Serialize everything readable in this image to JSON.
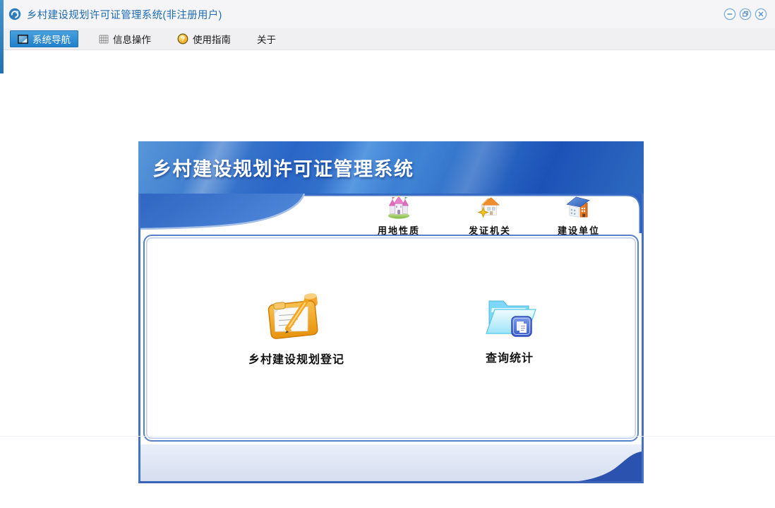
{
  "window": {
    "title": "乡村建设规划许可证管理系统(非注册用户)",
    "controls": {
      "minimize": "minimize",
      "maximize": "maximize",
      "close": "close"
    }
  },
  "menu": {
    "items": [
      {
        "label": "系统导航",
        "icon": "monitor-icon",
        "active": true
      },
      {
        "label": "信息操作",
        "icon": "grid-icon",
        "active": false
      },
      {
        "label": "使用指南",
        "icon": "help-icon",
        "active": false
      },
      {
        "label": "关于",
        "icon": null,
        "active": false
      }
    ]
  },
  "panel": {
    "banner_title": "乡村建设规划许可证管理系统",
    "tabs": [
      {
        "label": "用地性质",
        "icon": "castle-icon"
      },
      {
        "label": "发证机关",
        "icon": "house-icon"
      },
      {
        "label": "建设单位",
        "icon": "building-icon"
      }
    ],
    "actions": [
      {
        "label": "乡村建设规划登记",
        "icon": "clipboard-pen-icon"
      },
      {
        "label": "查询统计",
        "icon": "folder-docs-icon"
      }
    ]
  },
  "colors": {
    "accent_blue": "#2e8fd4",
    "title_text": "#1e6cb4",
    "banner_blue": "#2a66c6",
    "panel_border": "#4472c4",
    "footer_bg": "#d9e1f1",
    "footer_wave": "#2b52ae"
  }
}
